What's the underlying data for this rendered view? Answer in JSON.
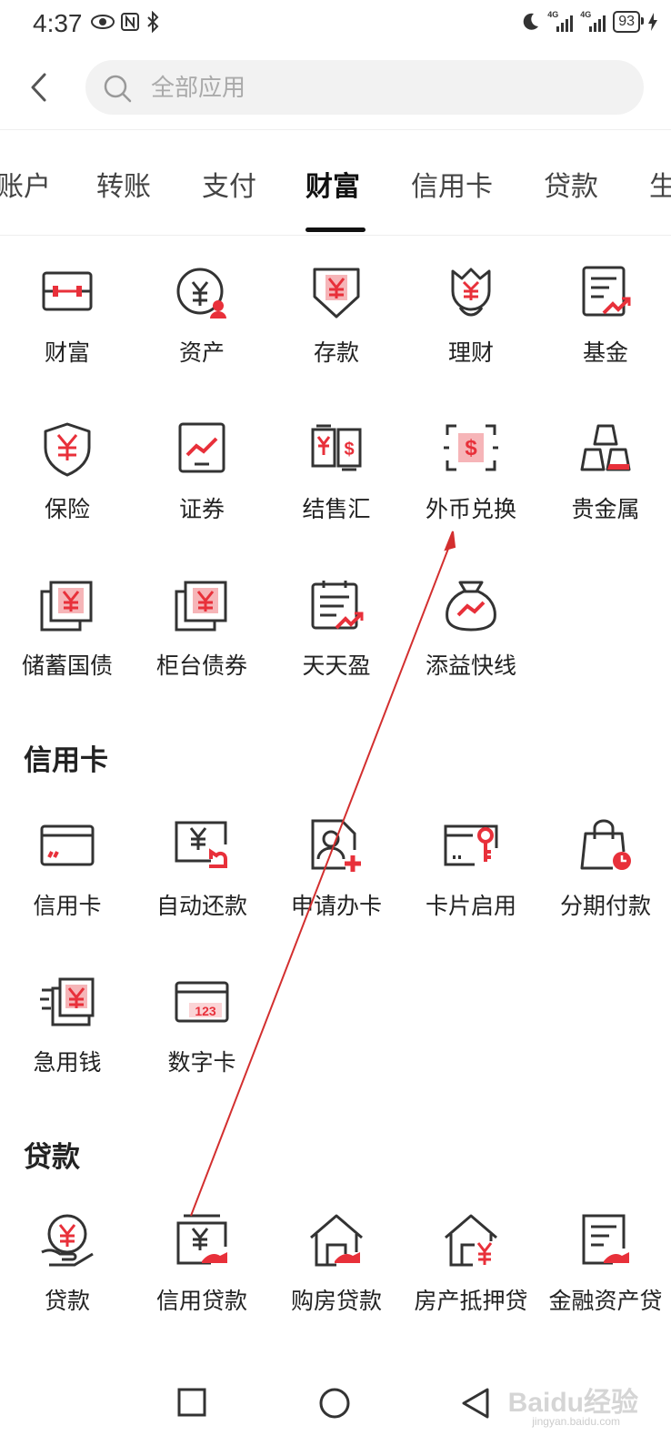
{
  "status_bar": {
    "time": "4:37",
    "battery": "93",
    "signal_label_1": "4G",
    "signal_label_2": "4G"
  },
  "search": {
    "placeholder": "全部应用"
  },
  "tabs": [
    {
      "label": "账户"
    },
    {
      "label": "转账"
    },
    {
      "label": "支付"
    },
    {
      "label": "财富",
      "active": true
    },
    {
      "label": "信用卡"
    },
    {
      "label": "贷款"
    },
    {
      "label": "生"
    }
  ],
  "wealth": {
    "items": [
      {
        "label": "财富",
        "icon": "wealth-icon"
      },
      {
        "label": "资产",
        "icon": "assets-icon"
      },
      {
        "label": "存款",
        "icon": "deposit-icon"
      },
      {
        "label": "理财",
        "icon": "financing-icon"
      },
      {
        "label": "基金",
        "icon": "fund-icon"
      },
      {
        "label": "保险",
        "icon": "insurance-icon"
      },
      {
        "label": "证券",
        "icon": "securities-icon"
      },
      {
        "label": "结售汇",
        "icon": "fx-settlement-icon"
      },
      {
        "label": "外币兑换",
        "icon": "currency-exchange-icon"
      },
      {
        "label": "贵金属",
        "icon": "precious-metals-icon"
      },
      {
        "label": "储蓄国债",
        "icon": "savings-bond-icon"
      },
      {
        "label": "柜台债券",
        "icon": "counter-bond-icon"
      },
      {
        "label": "天天盈",
        "icon": "daily-gain-icon"
      },
      {
        "label": "添益快线",
        "icon": "money-bag-icon"
      }
    ]
  },
  "credit": {
    "title": "信用卡",
    "items": [
      {
        "label": "信用卡",
        "icon": "credit-card-icon"
      },
      {
        "label": "自动还款",
        "icon": "auto-repay-icon"
      },
      {
        "label": "申请办卡",
        "icon": "apply-card-icon"
      },
      {
        "label": "卡片启用",
        "icon": "card-activate-icon"
      },
      {
        "label": "分期付款",
        "icon": "installment-icon"
      },
      {
        "label": "急用钱",
        "icon": "urgent-cash-icon"
      },
      {
        "label": "数字卡",
        "icon": "digital-card-icon"
      }
    ]
  },
  "loan": {
    "title": "贷款",
    "items": [
      {
        "label": "贷款",
        "icon": "loan-icon"
      },
      {
        "label": "信用贷款",
        "icon": "credit-loan-icon"
      },
      {
        "label": "购房贷款",
        "icon": "home-purchase-loan-icon"
      },
      {
        "label": "房产抵押贷",
        "icon": "mortgage-loan-icon"
      },
      {
        "label": "金融资产贷",
        "icon": "financial-asset-loan-icon"
      }
    ]
  },
  "digital_card_number": "123",
  "watermark": {
    "brand": "Baidu经验",
    "url": "jingyan.baidu.com"
  },
  "colors": {
    "accent": "#e8303a",
    "icon_stroke": "#333333",
    "arrow": "#d32f2f"
  }
}
